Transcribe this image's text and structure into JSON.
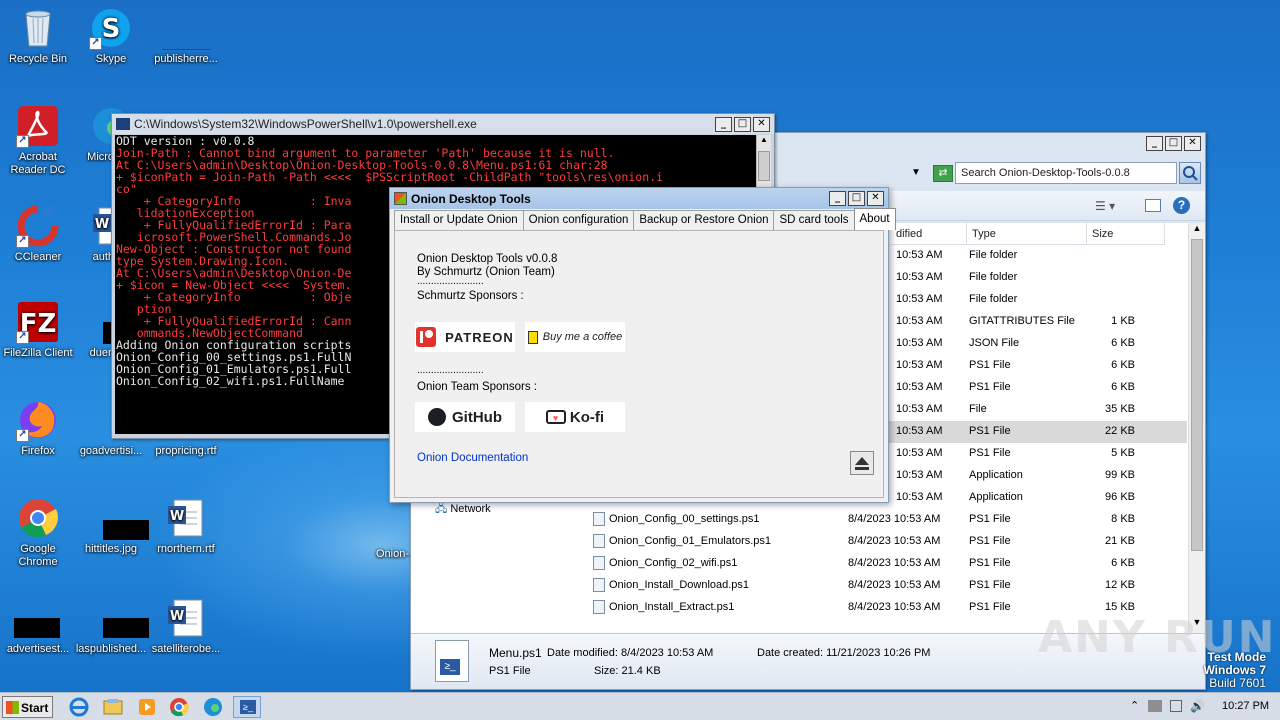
{
  "desktop": {
    "icons": [
      {
        "label": "Recycle Bin"
      },
      {
        "label": "Skype"
      },
      {
        "label": "publisherre..."
      },
      {
        "label": "Acrobat Reader DC"
      },
      {
        "label": "Microso..."
      },
      {
        "label": "CCleaner"
      },
      {
        "label": "autho..."
      },
      {
        "label": "FileZilla Client"
      },
      {
        "label": "duemo..."
      },
      {
        "label": "Firefox"
      },
      {
        "label": "goadvertisi..."
      },
      {
        "label": "propricing.rtf"
      },
      {
        "label": "Google Chrome"
      },
      {
        "label": "hittitles.jpg"
      },
      {
        "label": "rnorthern.rtf"
      },
      {
        "label": "Onion-..."
      },
      {
        "label": "advertisest..."
      },
      {
        "label": "laspublished..."
      },
      {
        "label": "satelliterobe..."
      }
    ]
  },
  "powershell": {
    "title": "C:\\Windows\\System32\\WindowsPowerShell\\v1.0\\powershell.exe",
    "lines": [
      {
        "text": "ODT version : v0.0.8",
        "c": "w"
      },
      {
        "text": "Join-Path : Cannot bind argument to parameter 'Path' because it is null.",
        "c": "r"
      },
      {
        "text": "At C:\\Users\\admin\\Desktop\\Onion-Desktop-Tools-0.0.8\\Menu.ps1:61 char:28",
        "c": "r"
      },
      {
        "text": "+ $iconPath = Join-Path -Path <<<<  $PSScriptRoot -ChildPath \"tools\\res\\onion.i",
        "c": "r"
      },
      {
        "text": "co\"",
        "c": "r"
      },
      {
        "text": "    + CategoryInfo          : Inva",
        "c": "r"
      },
      {
        "text": "   lidationException",
        "c": "r"
      },
      {
        "text": "    + FullyQualifiedErrorId : Para",
        "c": "r"
      },
      {
        "text": "   icrosoft.PowerShell.Commands.Jo",
        "c": "r"
      },
      {
        "text": "",
        "c": "w"
      },
      {
        "text": "New-Object : Constructor not found",
        "c": "r"
      },
      {
        "text": "type System.Drawing.Icon.",
        "c": "r"
      },
      {
        "text": "At C:\\Users\\admin\\Desktop\\Onion-De",
        "c": "r"
      },
      {
        "text": "+ $icon = New-Object <<<<  System.",
        "c": "r"
      },
      {
        "text": "    + CategoryInfo          : Obje",
        "c": "r"
      },
      {
        "text": "   ption",
        "c": "r"
      },
      {
        "text": "    + FullyQualifiedErrorId : Cann",
        "c": "r"
      },
      {
        "text": "   ommands.NewObjectCommand",
        "c": "r"
      },
      {
        "text": "",
        "c": "w"
      },
      {
        "text": "Adding Onion configuration scripts",
        "c": "w"
      },
      {
        "text": "Onion_Config_00_settings.ps1.FullN",
        "c": "w"
      },
      {
        "text": "Onion_Config_01_Emulators.ps1.Full",
        "c": "w"
      },
      {
        "text": "Onion_Config_02_wifi.ps1.FullName ",
        "c": "w"
      }
    ]
  },
  "explorer": {
    "search_placeholder": "Search Onion-Desktop-Tools-0.0.8",
    "columns": {
      "modified": "dified",
      "type": "Type",
      "size": "Size"
    },
    "rows": [
      {
        "name": "",
        "date": "10:53 AM",
        "type": "File folder",
        "size": ""
      },
      {
        "name": "",
        "date": "10:53 AM",
        "type": "File folder",
        "size": ""
      },
      {
        "name": "",
        "date": "10:53 AM",
        "type": "File folder",
        "size": ""
      },
      {
        "name": "",
        "date": "10:53 AM",
        "type": "GITATTRIBUTES File",
        "size": "1 KB"
      },
      {
        "name": "",
        "date": "10:53 AM",
        "type": "JSON File",
        "size": "6 KB"
      },
      {
        "name": "",
        "date": "10:53 AM",
        "type": "PS1 File",
        "size": "6 KB"
      },
      {
        "name": "",
        "date": "10:53 AM",
        "type": "PS1 File",
        "size": "6 KB"
      },
      {
        "name": "",
        "date": "10:53 AM",
        "type": "File",
        "size": "35 KB"
      },
      {
        "name": "",
        "date": "10:53 AM",
        "type": "PS1 File",
        "size": "22 KB"
      },
      {
        "name": "",
        "date": "10:53 AM",
        "type": "PS1 File",
        "size": "5 KB"
      },
      {
        "name": "",
        "date": "10:53 AM",
        "type": "Application",
        "size": "99 KB"
      },
      {
        "name": "",
        "date": "10:53 AM",
        "type": "Application",
        "size": "96 KB"
      },
      {
        "name": "Onion_Config_00_settings.ps1",
        "date": "8/4/2023 10:53 AM",
        "type": "PS1 File",
        "size": "8 KB"
      },
      {
        "name": "Onion_Config_01_Emulators.ps1",
        "date": "8/4/2023 10:53 AM",
        "type": "PS1 File",
        "size": "21 KB"
      },
      {
        "name": "Onion_Config_02_wifi.ps1",
        "date": "8/4/2023 10:53 AM",
        "type": "PS1 File",
        "size": "6 KB"
      },
      {
        "name": "Onion_Install_Download.ps1",
        "date": "8/4/2023 10:53 AM",
        "type": "PS1 File",
        "size": "12 KB"
      },
      {
        "name": "Onion_Install_Extract.ps1",
        "date": "8/4/2023 10:53 AM",
        "type": "PS1 File",
        "size": "15 KB"
      }
    ],
    "nav_network": "Network",
    "details": {
      "filename": "Menu.ps1",
      "modified_label": "Date modified: 8/4/2023 10:53 AM",
      "created_label": "Date created: 11/21/2023 10:26 PM",
      "type": "PS1 File",
      "size_label": "Size: 21.4 KB"
    }
  },
  "onion": {
    "title": "Onion Desktop Tools",
    "tabs": [
      "Install or Update Onion",
      "Onion configuration",
      "Backup or Restore Onion",
      "SD card tools",
      "About"
    ],
    "active_tab": "About",
    "about": {
      "version": "Onion Desktop Tools v0.0.8",
      "author": "By Schmurtz (Onion Team)",
      "sep1": "........................",
      "schmurtz_sponsors": "Schmurtz Sponsors :",
      "patreon": "PATREON",
      "bmac": "Buy me a coffee",
      "sep2": "........................",
      "team_sponsors": "Onion Team Sponsors :",
      "github": "GitHub",
      "kofi": "Ko-fi",
      "docs_link": "Onion Documentation"
    }
  },
  "taskbar": {
    "start": "Start",
    "clock": "10:27 PM"
  },
  "watermark": {
    "line1": "Test Mode",
    "line2": "Windows 7",
    "line3": "Build 7601",
    "brand": "ANY RUN"
  }
}
